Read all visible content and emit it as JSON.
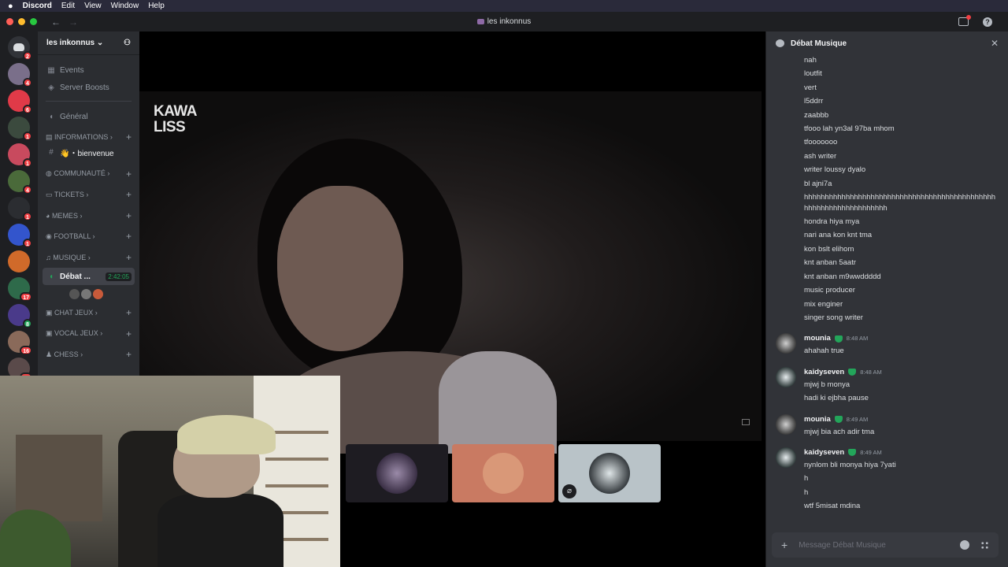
{
  "menubar": {
    "app_name": "Discord",
    "items": [
      "Edit",
      "View",
      "Window",
      "Help"
    ]
  },
  "window": {
    "title": "les inkonnus",
    "help_label": "?"
  },
  "guild_badges": [
    "2",
    "4",
    "6",
    "1",
    "1",
    "4",
    "1",
    "1",
    "",
    "17",
    "8",
    "16",
    "75",
    ""
  ],
  "server": {
    "name": "les inkonnus"
  },
  "channels": {
    "events": "Events",
    "boosts": "Server Boosts",
    "general": "Général",
    "cat_informations": "INFORMATIONS",
    "bienvenue": "👋・bienvenue",
    "cat_communaute": "COMMUNAUTÉ",
    "cat_tickets": "TICKETS",
    "cat_memes": "MEMES",
    "cat_football": "FOOTBALL",
    "cat_musique": "MUSIQUE",
    "active_voice": "Débat ...",
    "active_voice_time": "2:42:05",
    "cat_chat_jeux": "CHAT JEUX",
    "cat_vocal_jeux": "VOCAL JEUX",
    "cat_chess": "CHESS"
  },
  "stream": {
    "overlay_logo": "KAWA LISS"
  },
  "chat": {
    "title": "Débat Musique",
    "continuation_lines": [
      "nah",
      "loutfit",
      "vert",
      "l5ddrr",
      "zaabbb",
      "tfooo lah yn3al 97ba mhom",
      "tfooooooo",
      "ash writer",
      "writer loussy dyalo",
      "bl ajni7a"
    ],
    "wrapped_line": "hhhhhhhhhhhhhhhhhhhhhhhhhhhhhhhhhhhhhhhhhhhhhhhhhhhhhhhhhhhhhhhhhh",
    "continuation_lines_2": [
      "hondra hiya mya",
      "nari ana kon knt tma",
      "kon bslt elihom",
      "knt anban 5aatr",
      "knt anban m9wwddddd",
      "music producer",
      "mix enginer",
      "singer song writer"
    ],
    "messages": [
      {
        "author": "mounia",
        "time": "8:48 AM",
        "lines": [
          "ahahah true"
        ]
      },
      {
        "author": "kaidyseven",
        "time": "8:48 AM",
        "lines": [
          "mjwj b monya",
          "hadi ki ejbha pause"
        ]
      },
      {
        "author": "mounia",
        "time": "8:49 AM",
        "lines": [
          "mjwj bia ach adir tma"
        ]
      },
      {
        "author": "kaidyseven",
        "time": "8:49 AM",
        "lines": [
          "nynlom bli monya hiya 7yati",
          "h",
          "h",
          "wtf 5misat mdina"
        ]
      }
    ],
    "composer_placeholder": "Message Débat Musique"
  },
  "colors": {
    "accent_green": "#23a55a",
    "badge_red": "#f23f43",
    "tile_orange": "#c97a62",
    "tile_light": "#b9c3c8"
  }
}
